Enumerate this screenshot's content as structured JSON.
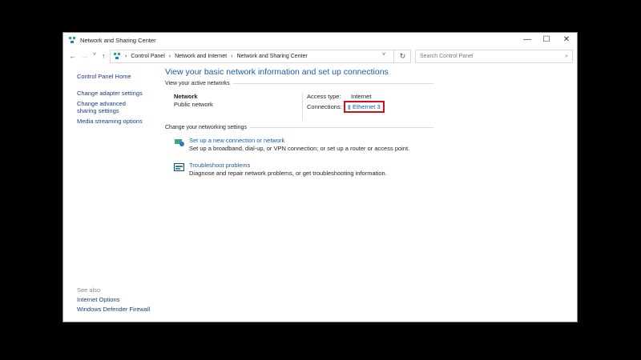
{
  "window": {
    "title": "Network and Sharing Center",
    "minimize": "—",
    "maximize": "☐",
    "close": "✕"
  },
  "nav": {
    "back": "←",
    "forward": "→",
    "recent": "˅",
    "up": "↑",
    "refresh": "↻",
    "dropdown": "˅",
    "breadcrumb": [
      "Control Panel",
      "Network and Internet",
      "Network and Sharing Center"
    ],
    "search_placeholder": "Search Control Panel",
    "search_icon": "⌕"
  },
  "sidebar": {
    "home": "Control Panel Home",
    "items": [
      "Change adapter settings",
      "Change advanced sharing settings",
      "Media streaming options"
    ],
    "see_also": "See also",
    "see_also_items": [
      "Internet Options",
      "Windows Defender Firewall"
    ]
  },
  "main": {
    "title": "View your basic network information and set up connections",
    "active_header": "View your active networks",
    "network_name": "Network",
    "network_type": "Public network",
    "access_label": "Access type:",
    "access_value": "Internet",
    "connections_label": "Connections:",
    "connection_value": "Ethernet 3",
    "change_header": "Change your networking settings",
    "tasks": [
      {
        "title": "Set up a new connection or network",
        "desc": "Set up a broadband, dial-up, or VPN connection; or set up a router or access point."
      },
      {
        "title": "Troubleshoot problems",
        "desc": "Diagnose and repair network problems, or get troubleshooting information."
      }
    ]
  },
  "colors": {
    "highlight": "#d0101a",
    "link": "#1e5aa8"
  }
}
